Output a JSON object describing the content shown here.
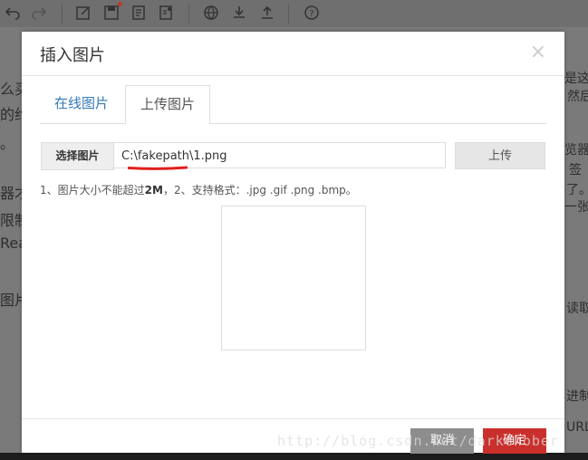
{
  "background": {
    "left_lines": [
      "么买",
      "的约",
      "。",
      "器才",
      "限制",
      "Rea",
      "图片"
    ],
    "right_lines": [
      "是这么",
      "然后",
      "览器",
      "签",
      "了。",
      "一张图",
      "读取",
      "进制",
      "URL"
    ]
  },
  "dialog": {
    "title": "插入图片",
    "close_symbol": "×",
    "tabs": [
      {
        "label": "在线图片",
        "active": false
      },
      {
        "label": "上传图片",
        "active": true
      }
    ],
    "choose_label": "选择图片",
    "file_path": "C:\\fakepath\\1.png",
    "upload_label": "上传",
    "hint_prefix": "1、图片大小不能超过",
    "hint_size": "2M",
    "hint_suffix": "，2、支持格式：.jpg .gif .png .bmp。",
    "cancel_label": "取消",
    "ok_label": "确定"
  },
  "watermark": "http://blog.csdn.net/darkchober",
  "colors": {
    "accent_red": "#c9302c",
    "tab_link": "#337ab7",
    "annotation_red": "#e0201a"
  }
}
